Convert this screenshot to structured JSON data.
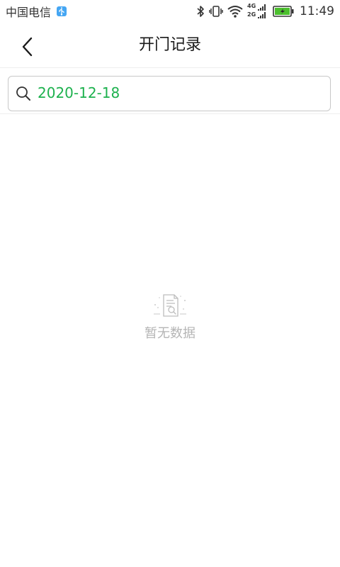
{
  "status_bar": {
    "carrier": "中国电信",
    "network_top": "4G",
    "network_bottom": "2G",
    "time": "11:49"
  },
  "header": {
    "title": "开门记录"
  },
  "search": {
    "value": "2020-12-18",
    "value_color": "#1db14e"
  },
  "empty": {
    "text": "暂无数据"
  },
  "colors": {
    "accent_green": "#1db14e",
    "battery_green": "#4cbf2e",
    "muted_gray": "#b5b5b5",
    "usb_blue": "#45a6f3"
  },
  "icons": {
    "back": "chevron-left-icon",
    "search": "search-icon",
    "empty": "document-icon",
    "usb": "usb-icon",
    "bluetooth": "bluetooth-icon",
    "vibrate": "vibrate-icon",
    "wifi": "wifi-icon",
    "signal": "signal-icon",
    "battery": "battery-icon"
  }
}
